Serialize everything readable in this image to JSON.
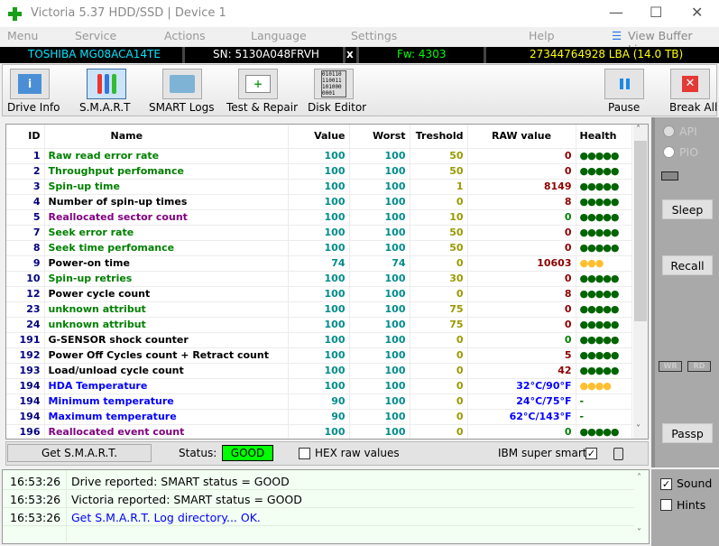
{
  "window": {
    "title": "Victoria 5.37 HDD/SSD | Device 1",
    "minimize": "—",
    "maximize": "☐",
    "close": "✕"
  },
  "menu": [
    "Menu",
    "Service",
    "Actions",
    "Language",
    "Settings",
    "Help"
  ],
  "view_buffer": "View Buffer Live",
  "drive": {
    "model": "TOSHIBA MG08ACA14TE",
    "serial": "SN: 5130A048FRVH",
    "close": "x",
    "firmware": "Fw: 4303",
    "capacity": "27344764928 LBA (14.0 TB)"
  },
  "toolbar": {
    "drive_info": "Drive Info",
    "smart": "S.M.A.R.T",
    "smart_logs": "SMART Logs",
    "test_repair": "Test & Repair",
    "disk_editor": "Disk Editor",
    "pause": "Pause",
    "break_all": "Break All"
  },
  "colors": {
    "good_name": "#008000",
    "neutral_name": "#000000",
    "realloc_name": "#800080",
    "temp_name": "#0000ff",
    "value": "#008b8b",
    "threshold": "#999900",
    "raw_red": "#8b0000",
    "raw_green": "#008000",
    "health_green": "#006400",
    "health_yellow": "#ffbf2f",
    "status_good": "#00ff00"
  },
  "table": {
    "headers": [
      "ID",
      "Name",
      "Value",
      "Worst",
      "Treshold",
      "RAW value",
      "Health"
    ],
    "rows": [
      {
        "id": "1",
        "name": "Raw read error rate",
        "type": "good",
        "value": "100",
        "worst": "100",
        "threshold": "50",
        "raw": "0",
        "raw_color": "raw_red",
        "health": "●●●●●",
        "health_color": "health_green"
      },
      {
        "id": "2",
        "name": "Throughput perfomance",
        "type": "good",
        "value": "100",
        "worst": "100",
        "threshold": "50",
        "raw": "0",
        "raw_color": "raw_red",
        "health": "●●●●●",
        "health_color": "health_green"
      },
      {
        "id": "3",
        "name": "Spin-up time",
        "type": "good",
        "value": "100",
        "worst": "100",
        "threshold": "1",
        "raw": "8149",
        "raw_color": "raw_red",
        "health": "●●●●●",
        "health_color": "health_green"
      },
      {
        "id": "4",
        "name": "Number of spin-up times",
        "type": "neutral",
        "value": "100",
        "worst": "100",
        "threshold": "0",
        "raw": "8",
        "raw_color": "raw_red",
        "health": "●●●●●",
        "health_color": "health_green"
      },
      {
        "id": "5",
        "name": "Reallocated sector count",
        "type": "realloc",
        "value": "100",
        "worst": "100",
        "threshold": "10",
        "raw": "0",
        "raw_color": "raw_green",
        "health": "●●●●●",
        "health_color": "health_green"
      },
      {
        "id": "7",
        "name": "Seek error rate",
        "type": "good",
        "value": "100",
        "worst": "100",
        "threshold": "50",
        "raw": "0",
        "raw_color": "raw_red",
        "health": "●●●●●",
        "health_color": "health_green"
      },
      {
        "id": "8",
        "name": "Seek time perfomance",
        "type": "good",
        "value": "100",
        "worst": "100",
        "threshold": "50",
        "raw": "0",
        "raw_color": "raw_red",
        "health": "●●●●●",
        "health_color": "health_green"
      },
      {
        "id": "9",
        "name": "Power-on time",
        "type": "neutral",
        "value": "74",
        "worst": "74",
        "threshold": "0",
        "raw": "10603",
        "raw_color": "raw_red",
        "health": "●●●",
        "health_color": "health_yellow"
      },
      {
        "id": "10",
        "name": "Spin-up retries",
        "type": "good",
        "value": "100",
        "worst": "100",
        "threshold": "30",
        "raw": "0",
        "raw_color": "raw_red",
        "health": "●●●●●",
        "health_color": "health_green"
      },
      {
        "id": "12",
        "name": "Power cycle count",
        "type": "neutral",
        "value": "100",
        "worst": "100",
        "threshold": "0",
        "raw": "8",
        "raw_color": "raw_red",
        "health": "●●●●●",
        "health_color": "health_green"
      },
      {
        "id": "23",
        "name": "unknown attribut",
        "type": "good",
        "value": "100",
        "worst": "100",
        "threshold": "75",
        "raw": "0",
        "raw_color": "raw_red",
        "health": "●●●●●",
        "health_color": "health_green"
      },
      {
        "id": "24",
        "name": "unknown attribut",
        "type": "good",
        "value": "100",
        "worst": "100",
        "threshold": "75",
        "raw": "0",
        "raw_color": "raw_red",
        "health": "●●●●●",
        "health_color": "health_green"
      },
      {
        "id": "191",
        "name": "G-SENSOR shock counter",
        "type": "neutral",
        "value": "100",
        "worst": "100",
        "threshold": "0",
        "raw": "0",
        "raw_color": "raw_green",
        "health": "●●●●●",
        "health_color": "health_green"
      },
      {
        "id": "192",
        "name": "Power Off Cycles count + Retract count",
        "type": "neutral",
        "value": "100",
        "worst": "100",
        "threshold": "0",
        "raw": "5",
        "raw_color": "raw_red",
        "health": "●●●●●",
        "health_color": "health_green"
      },
      {
        "id": "193",
        "name": "Load/unload cycle count",
        "type": "neutral",
        "value": "100",
        "worst": "100",
        "threshold": "0",
        "raw": "42",
        "raw_color": "raw_red",
        "health": "●●●●●",
        "health_color": "health_green"
      },
      {
        "id": "194",
        "name": "HDA Temperature",
        "type": "temp",
        "value": "100",
        "worst": "100",
        "threshold": "0",
        "raw": "32°C/90°F",
        "raw_color": "temp_name",
        "health": "●●●●",
        "health_color": "health_yellow"
      },
      {
        "id": "194",
        "name": "Minimum temperature",
        "type": "temp",
        "value": "90",
        "worst": "100",
        "threshold": "0",
        "raw": "24°C/75°F",
        "raw_color": "temp_name",
        "health": "-",
        "health_color": "health_green"
      },
      {
        "id": "194",
        "name": "Maximum temperature",
        "type": "temp",
        "value": "90",
        "worst": "100",
        "threshold": "0",
        "raw": "62°C/143°F",
        "raw_color": "temp_name",
        "health": "-",
        "health_color": "health_green"
      },
      {
        "id": "196",
        "name": "Reallocated event count",
        "type": "realloc",
        "value": "100",
        "worst": "100",
        "threshold": "0",
        "raw": "0",
        "raw_color": "raw_green",
        "health": "●●●●●",
        "health_color": "health_green"
      }
    ]
  },
  "side": {
    "api": "API",
    "pio": "PIO",
    "sleep": "Sleep",
    "recall": "Recall",
    "wr": "WR",
    "rd": "RD",
    "passp": "Passp",
    "sound": "Sound",
    "hints": "Hints"
  },
  "status": {
    "get_smart": "Get S.M.A.R.T.",
    "label": "Status:",
    "value": "GOOD",
    "hex": "HEX raw values",
    "ibm": "IBM super smart:",
    "ibm_checked": true
  },
  "log": [
    {
      "time": "16:53:26",
      "text": "Drive reported: SMART status = GOOD",
      "color": "#000000"
    },
    {
      "time": "16:53:26",
      "text": "Victoria reported: SMART status = GOOD",
      "color": "#000000"
    },
    {
      "time": "16:53:26",
      "text": "Get S.M.A.R.T. Log directory... OK.",
      "color": "#0000ff"
    }
  ]
}
